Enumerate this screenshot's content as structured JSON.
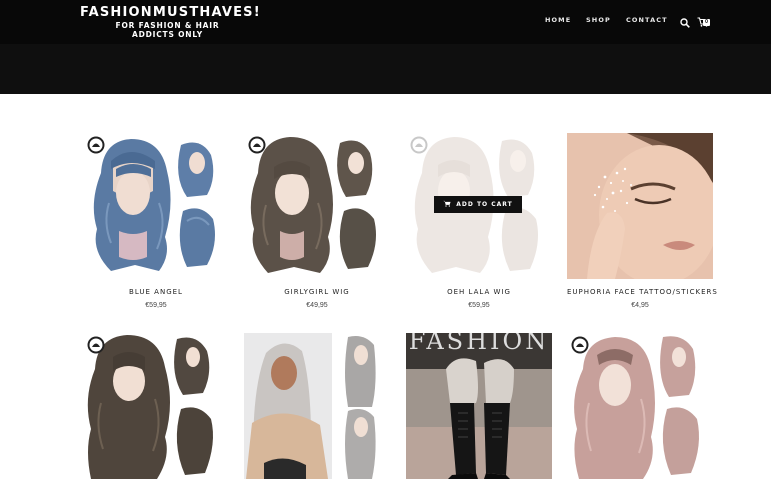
{
  "header": {
    "brand_title": "FASHIONMUSTHAVES!",
    "brand_tagline": "FOR FASHION & HAIR ADDICTS ONLY",
    "nav": [
      "HOME",
      "SHOP",
      "CONTACT"
    ],
    "search_icon": "search-icon",
    "cart_icon": "cart-icon",
    "cart_count": "0"
  },
  "products": [
    {
      "name": "BLUE ANGEL",
      "price": "€59,95",
      "image": "blue wavy wig with bangs"
    },
    {
      "name": "GIRLYGIRL WIG",
      "price": "€49,95",
      "image": "brown wavy wig with bangs"
    },
    {
      "name": "OEH LALA WIG",
      "price": "€59,95",
      "image": "light blonde wavy wig",
      "add_to_cart_label": "ADD TO CART"
    },
    {
      "name": "EUPHORIA FACE TATTOO/STICKERS",
      "price": "€4,95",
      "image": "face glitter stickers"
    },
    {
      "name": "",
      "price": "",
      "image": "dark brown curly wig"
    },
    {
      "name": "",
      "price": "",
      "image": "grey long straight wig"
    },
    {
      "name": "",
      "price": "",
      "image": "lace-up black boots",
      "image_text": "FASHION"
    },
    {
      "name": "",
      "price": "",
      "image": "pink wavy wig"
    }
  ],
  "colors": {
    "header_bg": "#080808",
    "hero_bg": "#0f0f0f",
    "button_bg": "#111111",
    "text": "#222222"
  }
}
